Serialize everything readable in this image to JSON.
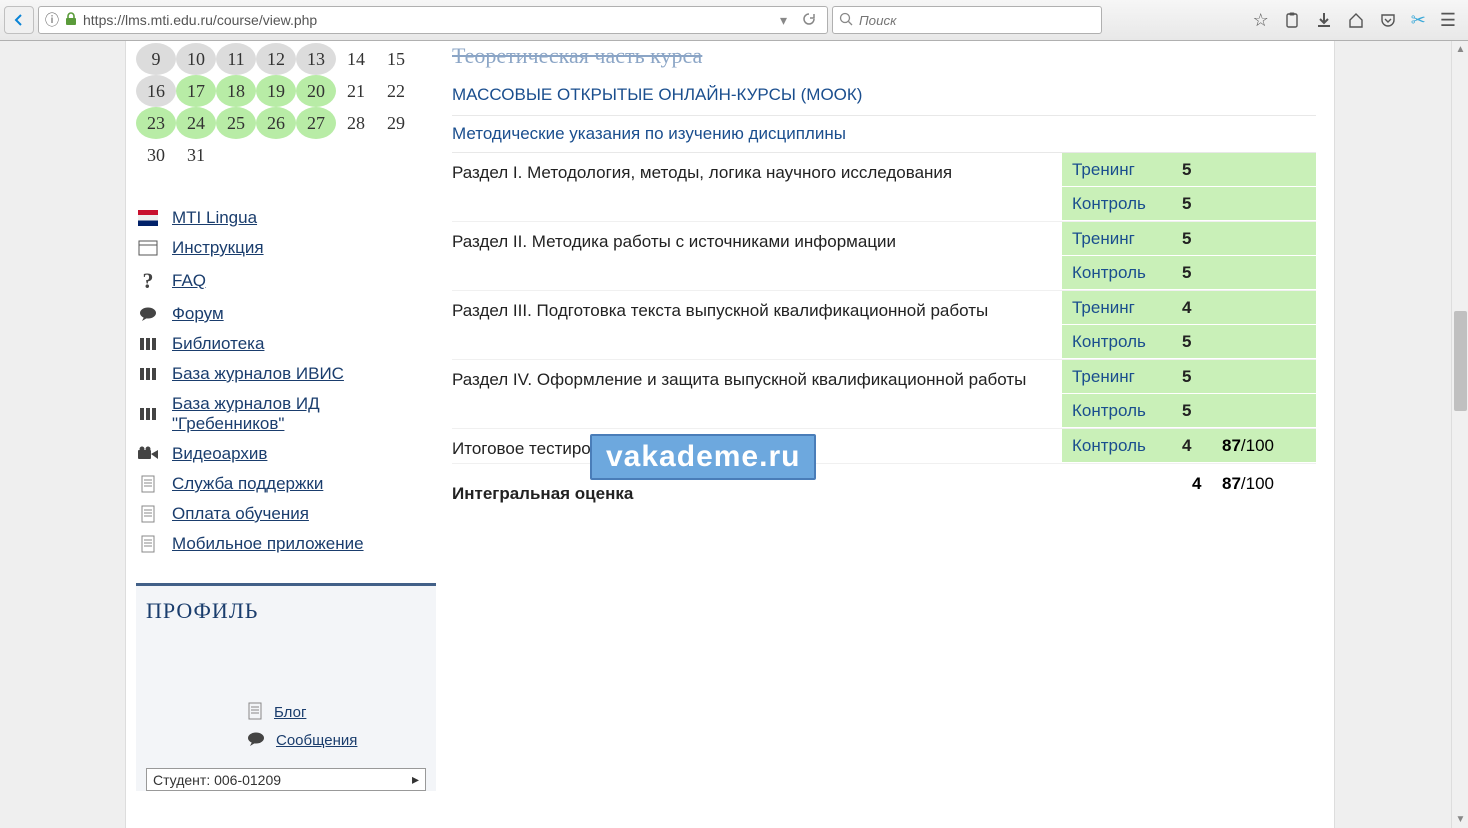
{
  "browser": {
    "url": "https://lms.mti.edu.ru/course/view.php",
    "search_placeholder": "Поиск"
  },
  "calendar": {
    "rows": [
      [
        {
          "d": "9",
          "c": "hl-grey"
        },
        {
          "d": "10",
          "c": "hl-grey"
        },
        {
          "d": "11",
          "c": "hl-grey"
        },
        {
          "d": "12",
          "c": "hl-grey"
        },
        {
          "d": "13",
          "c": "hl-grey"
        },
        {
          "d": "14",
          "c": ""
        },
        {
          "d": "15",
          "c": ""
        }
      ],
      [
        {
          "d": "16",
          "c": "hl-grey"
        },
        {
          "d": "17",
          "c": "hl-green"
        },
        {
          "d": "18",
          "c": "hl-green"
        },
        {
          "d": "19",
          "c": "hl-green"
        },
        {
          "d": "20",
          "c": "hl-green"
        },
        {
          "d": "21",
          "c": ""
        },
        {
          "d": "22",
          "c": ""
        }
      ],
      [
        {
          "d": "23",
          "c": "hl-green"
        },
        {
          "d": "24",
          "c": "hl-green"
        },
        {
          "d": "25",
          "c": "hl-green"
        },
        {
          "d": "26",
          "c": "hl-green"
        },
        {
          "d": "27",
          "c": "hl-green"
        },
        {
          "d": "28",
          "c": ""
        },
        {
          "d": "29",
          "c": ""
        }
      ],
      [
        {
          "d": "30",
          "c": ""
        },
        {
          "d": "31",
          "c": ""
        },
        {
          "d": "",
          "c": ""
        },
        {
          "d": "",
          "c": ""
        },
        {
          "d": "",
          "c": ""
        },
        {
          "d": "",
          "c": ""
        },
        {
          "d": "",
          "c": ""
        }
      ]
    ]
  },
  "sidebar_links": [
    {
      "label": "MTI Lingua",
      "icon": "flag"
    },
    {
      "label": "Инструкция",
      "icon": "window"
    },
    {
      "label": "FAQ",
      "icon": "question"
    },
    {
      "label": "Форум",
      "icon": "chat"
    },
    {
      "label": "Библиотека",
      "icon": "books"
    },
    {
      "label": "База журналов ИВИС",
      "icon": "books"
    },
    {
      "label": "База журналов ИД \"Гребенников\"",
      "icon": "books"
    },
    {
      "label": "Видеоархив",
      "icon": "video"
    },
    {
      "label": "Служба поддержки",
      "icon": "doc"
    },
    {
      "label": "Оплата обучения",
      "icon": "doc"
    },
    {
      "label": "Мобильное приложение",
      "icon": "doc"
    }
  ],
  "profile": {
    "title": "ПРОФИЛЬ",
    "links": [
      {
        "label": "Блог",
        "icon": "doc"
      },
      {
        "label": "Сообщения",
        "icon": "chat"
      }
    ],
    "select_value": "Студент: 006-01209"
  },
  "course": {
    "header_cut": "Теоретическая часть курса",
    "link_mook": "МАССОВЫЕ ОТКРЫТЫЕ ОНЛАЙН-КУРСЫ (МООК)",
    "link_method": "Методические указания по изучению дисциплины",
    "sections": [
      {
        "title": "Раздел I. Методология, методы, логика научного исследования",
        "tracks": [
          {
            "t": "Тренинг",
            "s": "5"
          },
          {
            "t": "Контроль",
            "s": "5"
          }
        ]
      },
      {
        "title": "Раздел II. Методика работы с источниками информации",
        "tracks": [
          {
            "t": "Тренинг",
            "s": "5"
          },
          {
            "t": "Контроль",
            "s": "5"
          }
        ]
      },
      {
        "title": "Раздел III. Подготовка текста выпускной квалификационной работы",
        "tracks": [
          {
            "t": "Тренинг",
            "s": "4"
          },
          {
            "t": "Контроль",
            "s": "5"
          }
        ]
      },
      {
        "title": "Раздел IV. Оформление и защита выпускной квалификационной работы",
        "tracks": [
          {
            "t": "Тренинг",
            "s": "5"
          },
          {
            "t": "Контроль",
            "s": "5"
          }
        ]
      },
      {
        "title": "Итоговое тестирование",
        "tracks": [
          {
            "t": "Контроль",
            "s": "4",
            "extra_bold": "87",
            "extra_rest": "/100"
          }
        ]
      }
    ],
    "final": {
      "title": "Интегральная оценка",
      "s": "4",
      "extra_bold": "87",
      "extra_rest": "/100"
    }
  },
  "watermark": "vakademe.ru"
}
